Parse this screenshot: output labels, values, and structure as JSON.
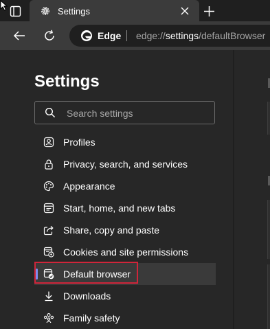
{
  "tab": {
    "title": "Settings"
  },
  "address": {
    "brand": "Edge",
    "url_prefix": "edge://",
    "url_strong": "settings",
    "url_suffix": "/defaultBrowser"
  },
  "sidebar": {
    "title": "Settings",
    "search_placeholder": "Search settings",
    "items": [
      {
        "label": "Profiles",
        "icon": "profile-icon"
      },
      {
        "label": "Privacy, search, and services",
        "icon": "lock-icon"
      },
      {
        "label": "Appearance",
        "icon": "palette-icon"
      },
      {
        "label": "Start, home, and new tabs",
        "icon": "power-icon"
      },
      {
        "label": "Share, copy and paste",
        "icon": "share-icon"
      },
      {
        "label": "Cookies and site permissions",
        "icon": "cookies-icon"
      },
      {
        "label": "Default browser",
        "icon": "default-browser-icon",
        "selected": true
      },
      {
        "label": "Downloads",
        "icon": "download-icon"
      },
      {
        "label": "Family safety",
        "icon": "family-icon"
      }
    ]
  },
  "colors": {
    "accent": "#7f8ef0",
    "highlight_border": "#d0253a",
    "background": "#272727",
    "toolbar": "#3b3b3b"
  }
}
